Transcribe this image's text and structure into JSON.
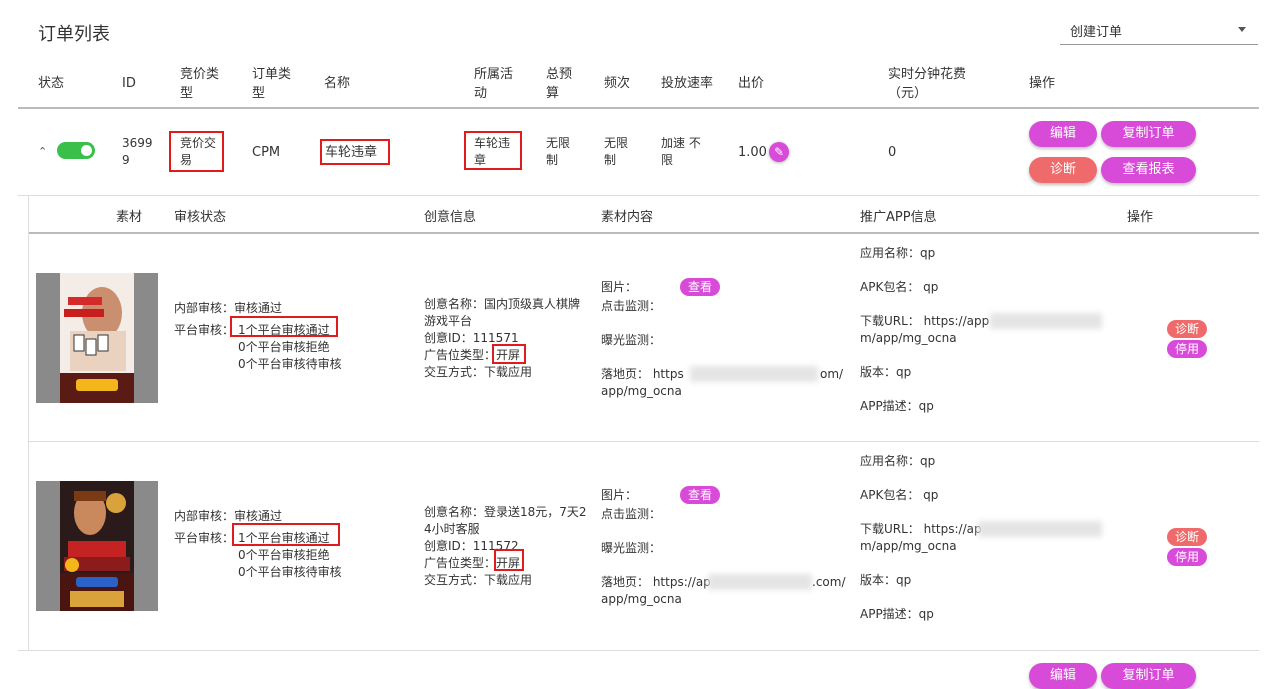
{
  "page": {
    "title": "订单列表"
  },
  "create_select": {
    "label": "创建订单"
  },
  "columns": {
    "status": "状态",
    "id": "ID",
    "bid_type_1": "竞价类",
    "bid_type_2": "型",
    "order_type_1": "订单类",
    "order_type_2": "型",
    "name": "名称",
    "activity_1": "所属活",
    "activity_2": "动",
    "budget_1": "总预",
    "budget_2": "算",
    "frequency": "频次",
    "speed": "投放速率",
    "bid": "出价",
    "spend_1": "实时分钟花费",
    "spend_2": "（元）",
    "actions": "操作"
  },
  "order": {
    "id_1": "3699",
    "id_2": "9",
    "bid_type_1": "竞价交",
    "bid_type_2": "易",
    "order_type": "CPM",
    "name": "车轮违章",
    "activity_1": "车轮违",
    "activity_2": "章",
    "budget_1": "无限",
    "budget_2": "制",
    "frequency_1": "无限",
    "frequency_2": "制",
    "speed_1": "加速 不",
    "speed_2": "限",
    "bid": "1.00",
    "spend": "0",
    "buttons": {
      "edit": "编辑",
      "copy": "复制订单",
      "diagnose": "诊断",
      "report": "查看报表"
    }
  },
  "sub_columns": {
    "material": "素材",
    "review": "审核状态",
    "creative": "创意信息",
    "content": "素材内容",
    "app": "推广APP信息",
    "actions": "操作"
  },
  "creatives": [
    {
      "review": {
        "internal": "内部审核：审核通过",
        "platform_label": "平台审核：",
        "passed": "1个平台审核通过",
        "rejected": "0个平台审核拒绝",
        "pending": "0个平台审核待审核"
      },
      "creative": {
        "name_1": "创意名称：国内顶级真人棋牌",
        "name_2": "游戏平台",
        "id": "创意ID：111571",
        "ad_type_label": "广告位类型：",
        "ad_type": "开屏",
        "interaction": "交互方式：下载应用"
      },
      "content": {
        "image": "图片：",
        "view": "查看",
        "click": "点击监测：",
        "expose": "曝光监测：",
        "landing_1": "落地页： https",
        "landing_tail": "om/",
        "landing_2": "app/mg_ocna"
      },
      "app": {
        "name": "应用名称：qp",
        "apk": "APK包名： qp",
        "url_1": "下载URL： https://app",
        "url_2": "m/app/mg_ocna",
        "version": "版本：qp",
        "desc": "APP描述：qp"
      },
      "actions": {
        "diagnose": "诊断",
        "disable": "停用"
      }
    },
    {
      "review": {
        "internal": "内部审核：审核通过",
        "platform_label": "平台审核：",
        "passed": "1个平台审核通过",
        "rejected": "0个平台审核拒绝",
        "pending": "0个平台审核待审核"
      },
      "creative": {
        "name_1": "创意名称：登录送18元，7天2",
        "name_2": "4小时客服",
        "id": "创意ID：111572",
        "ad_type_label": "广告位类型：",
        "ad_type": "开屏",
        "interaction": "交互方式：下载应用"
      },
      "content": {
        "image": "图片：",
        "view": "查看",
        "click": "点击监测：",
        "expose": "曝光监测：",
        "landing_1": "落地页： https://ap",
        "landing_tail": ".com/",
        "landing_2": "app/mg_ocna"
      },
      "app": {
        "name": "应用名称：qp",
        "apk": "APK包名： qp",
        "url_1": "下载URL： https://ap",
        "url_2": "m/app/mg_ocna",
        "version": "版本：qp",
        "desc": "APP描述：qp"
      },
      "actions": {
        "diagnose": "诊断",
        "disable": "停用"
      }
    }
  ],
  "next_order": {
    "edit": "编辑",
    "copy": "复制订单"
  },
  "colors": {
    "purple": "#d74bd8",
    "coral": "#ef6b6b",
    "toggle_on": "#3bbf4b",
    "highlight": "#e01b1b"
  }
}
